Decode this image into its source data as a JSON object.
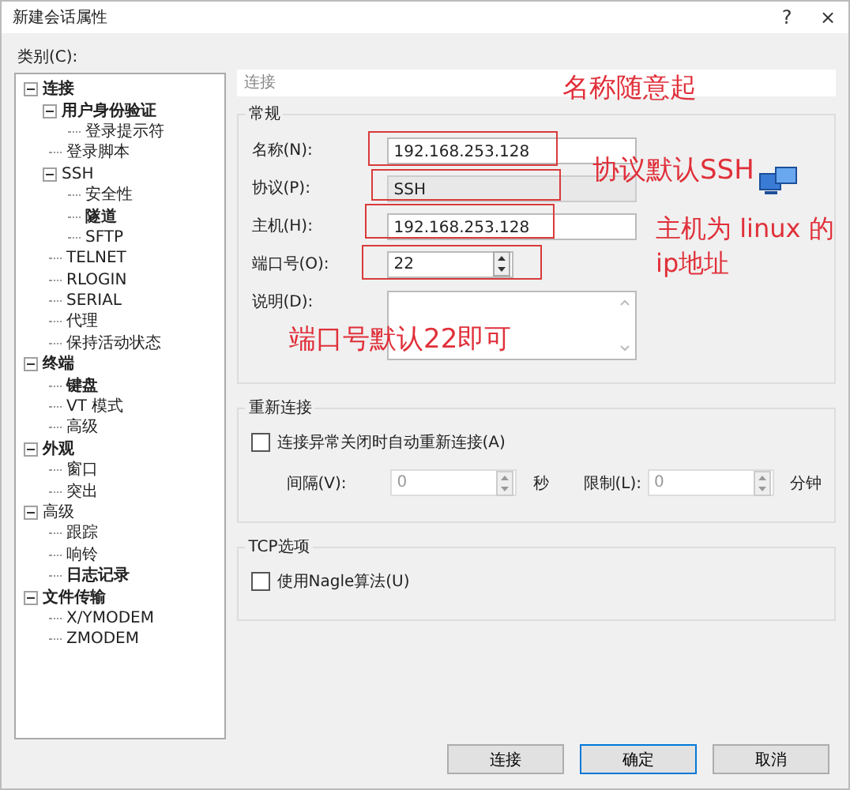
{
  "window": {
    "title": "新建会话属性",
    "help_button": "?",
    "close_button": "×"
  },
  "category_label": "类别(C):",
  "tree": [
    {
      "label": "连接",
      "bold": true,
      "expanded": true,
      "children": [
        {
          "label": "用户身份验证",
          "bold": true,
          "expanded": true,
          "children": [
            {
              "label": "登录提示符",
              "bold": false
            }
          ]
        },
        {
          "label": "登录脚本",
          "bold": false
        },
        {
          "label": "SSH",
          "bold": false,
          "expanded": true,
          "children": [
            {
              "label": "安全性",
              "bold": false
            },
            {
              "label": "隧道",
              "bold": true
            },
            {
              "label": "SFTP",
              "bold": false
            }
          ]
        },
        {
          "label": "TELNET",
          "bold": false
        },
        {
          "label": "RLOGIN",
          "bold": false
        },
        {
          "label": "SERIAL",
          "bold": false
        },
        {
          "label": "代理",
          "bold": false
        },
        {
          "label": "保持活动状态",
          "bold": false
        }
      ]
    },
    {
      "label": "终端",
      "bold": true,
      "expanded": true,
      "children": [
        {
          "label": "键盘",
          "bold": true
        },
        {
          "label": "VT 模式",
          "bold": false
        },
        {
          "label": "高级",
          "bold": false
        }
      ]
    },
    {
      "label": "外观",
      "bold": true,
      "expanded": true,
      "children": [
        {
          "label": "窗口",
          "bold": false
        },
        {
          "label": "突出",
          "bold": false
        }
      ]
    },
    {
      "label": "高级",
      "bold": false,
      "expanded": true,
      "children": [
        {
          "label": "跟踪",
          "bold": false
        },
        {
          "label": "响铃",
          "bold": false
        },
        {
          "label": "日志记录",
          "bold": true
        }
      ]
    },
    {
      "label": "文件传输",
      "bold": true,
      "expanded": true,
      "children": [
        {
          "label": "X/YMODEM",
          "bold": false
        },
        {
          "label": "ZMODEM",
          "bold": false
        }
      ]
    }
  ],
  "page_title": "连接",
  "general": {
    "title": "常规",
    "fields": [
      {
        "kind": "text",
        "label": "名称(N):",
        "value": "192.168.253.128",
        "highlighted": true
      },
      {
        "kind": "select",
        "label": "协议(P):",
        "value": "SSH",
        "highlighted": true
      },
      {
        "kind": "text",
        "label": "主机(H):",
        "value": "192.168.253.128",
        "highlighted": true
      },
      {
        "kind": "spin",
        "label": "端口号(O):",
        "value": "22",
        "highlighted": true
      },
      {
        "kind": "textarea",
        "label": "说明(D):",
        "highlighted": false
      }
    ]
  },
  "reconnect": {
    "title": "重新连接",
    "checkbox": {
      "label": "连接异常关闭时自动重新连接(A)",
      "checked": false
    },
    "interval": {
      "label": "间隔(V):",
      "value": "0",
      "unit": "秒",
      "disabled": true
    },
    "limit": {
      "label": "限制(L):",
      "value": "0",
      "unit": "分钟",
      "disabled": true
    }
  },
  "tcp": {
    "title": "TCP选项",
    "checkbox": {
      "label": "使用Nagle算法(U)",
      "checked": false
    }
  },
  "buttons": [
    {
      "label": "连接",
      "default": false
    },
    {
      "label": "确定",
      "default": true
    },
    {
      "label": "取消",
      "default": false
    }
  ],
  "annotations": [
    {
      "text": "名称随意起"
    },
    {
      "text": "协议默认SSH"
    },
    {
      "text": "主机为 linux 的 ip地址"
    },
    {
      "text": "端口号默认22即可"
    }
  ]
}
